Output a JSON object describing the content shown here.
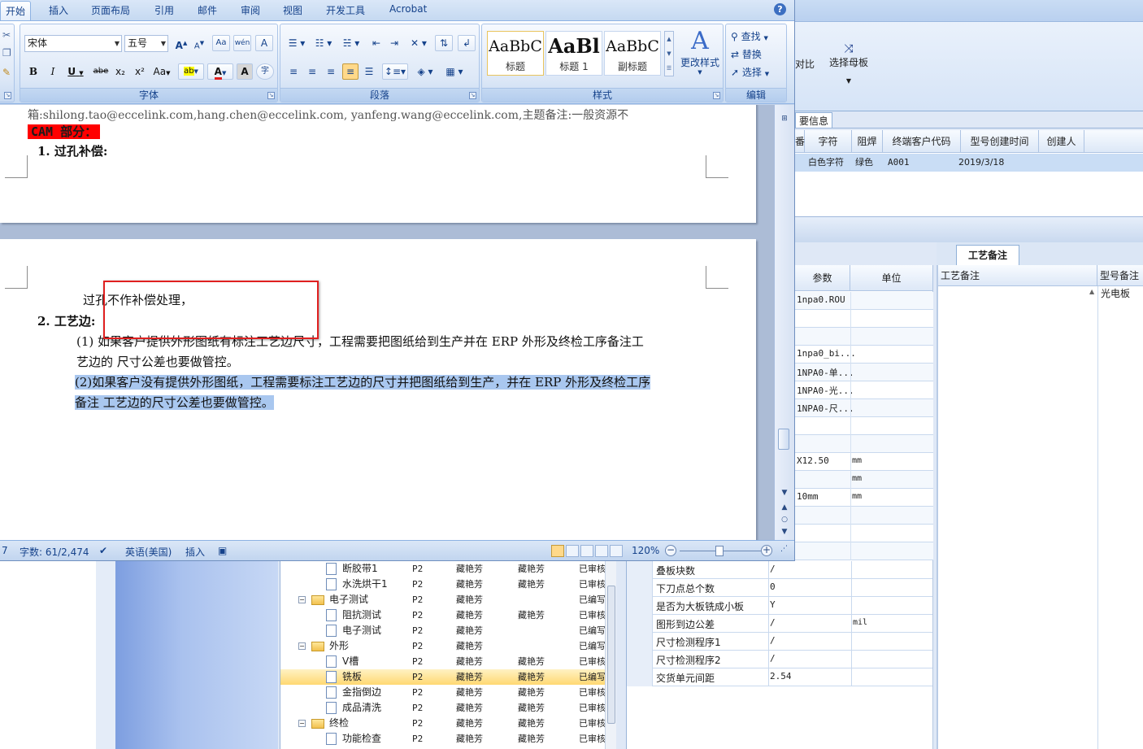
{
  "word": {
    "tabs": [
      "开始",
      "插入",
      "页面布局",
      "引用",
      "邮件",
      "审阅",
      "视图",
      "开发工具",
      "Acrobat"
    ],
    "font": {
      "name": "宋体",
      "size": "五号",
      "group_label": "字体",
      "btn_grow": "A",
      "btn_shrink": "A",
      "btn_clear": "Aa",
      "btn_phonetic": "wén",
      "btn_border_char": "A",
      "btn_bold": "B",
      "btn_italic": "I",
      "btn_underline": "U",
      "btn_strike": "abe",
      "btn_sub": "x₂",
      "btn_sup": "x²",
      "btn_case": "Aa",
      "btn_highlight": "ab",
      "btn_color": "A",
      "btn_shade": "A",
      "btn_enclose": "字"
    },
    "paragraph": {
      "group_label": "段落"
    },
    "styles": {
      "group_label": "样式",
      "items": [
        {
          "sample": "AaBbC",
          "name": "标题"
        },
        {
          "sample": "AaBl",
          "name": "标题 1"
        },
        {
          "sample": "AaBbC",
          "name": "副标题"
        }
      ],
      "change_styles": "更改样式"
    },
    "editing": {
      "group_label": "编辑",
      "find": "查找",
      "replace": "替换",
      "select": "选择"
    },
    "document": {
      "top_line": "箱:shilong.tao@eccelink.com,hang.chen@eccelink.com, yanfeng.wang@eccelink.com,主题备注:一般资源不",
      "cam_heading": "CAM 部分：",
      "item1": "1. 过孔补偿:",
      "p2_line1": "过孔不作补偿处理，",
      "item2": "2. 工艺边:",
      "para1_line1": "(1) 如果客户提供外形图纸有标注工艺边尺寸，工程需要把图纸给到生产并在 ERP 外形及终检工序备注工",
      "para1_line2": "艺边的 尺寸公差也要做管控。",
      "para2_line1": "(2)如果客户没有提供外形图纸，工程需要标注工艺边的尺寸并把图纸给到生产，并在 ERP 外形及终检工序",
      "para2_line2": "备注  工艺边的尺寸公差也要做管控。"
    },
    "status": {
      "page": "7",
      "words": "字数: 61/2,474",
      "language": "英语(美国)",
      "mode": "插入",
      "zoom": "120%"
    }
  },
  "erp": {
    "ribbon": {
      "compare": "对比",
      "select_template": "选择母板"
    },
    "info_tab": "要信息",
    "grid_headers": [
      "番",
      "字符",
      "阻焊",
      "终端客户代码",
      "型号创建时间",
      "创建人"
    ],
    "grid_row": [
      "",
      "白色字符",
      "绿色",
      "A001",
      "2019/3/18",
      ""
    ],
    "param_headers": {
      "param": "参数",
      "unit": "单位"
    },
    "param_rows": [
      {
        "v": "1npa0.ROU",
        "u": ""
      },
      {
        "v": "",
        "u": ""
      },
      {
        "v": "",
        "u": ""
      },
      {
        "v": "1npa0_bi...",
        "u": ""
      },
      {
        "v": "1NPA0-单...",
        "u": ""
      },
      {
        "v": "1NPA0-光...",
        "u": ""
      },
      {
        "v": "1NPA0-尺...",
        "u": ""
      },
      {
        "v": "",
        "u": ""
      },
      {
        "v": "",
        "u": ""
      },
      {
        "v": "X12.50",
        "u": "mm"
      },
      {
        "v": "",
        "u": "mm"
      },
      {
        "v": "10mm",
        "u": "mm"
      },
      {
        "v": "",
        "u": ""
      },
      {
        "v": "",
        "u": ""
      },
      {
        "v": "",
        "u": ""
      }
    ],
    "note_tab": "工艺备注",
    "note_headers": {
      "process_note": "工艺备注",
      "model_note": "型号备注"
    },
    "model_note_value": "光电板",
    "tree": [
      {
        "level": 2,
        "type": "doc",
        "name": "断胶带1",
        "p": "P2",
        "a": "藏艳芳",
        "b": "藏艳芳",
        "s": "已审核"
      },
      {
        "level": 2,
        "type": "doc",
        "name": "水洗烘干1",
        "p": "P2",
        "a": "藏艳芳",
        "b": "藏艳芳",
        "s": "已审核"
      },
      {
        "level": 1,
        "type": "folder",
        "name": "电子测试",
        "p": "P2",
        "a": "藏艳芳",
        "b": "",
        "s": "已编写"
      },
      {
        "level": 2,
        "type": "doc",
        "name": "阻抗测试",
        "p": "P2",
        "a": "藏艳芳",
        "b": "藏艳芳",
        "s": "已审核"
      },
      {
        "level": 2,
        "type": "doc",
        "name": "电子测试",
        "p": "P2",
        "a": "藏艳芳",
        "b": "",
        "s": "已编写"
      },
      {
        "level": 1,
        "type": "folder",
        "name": "外形",
        "p": "P2",
        "a": "藏艳芳",
        "b": "",
        "s": "已编写"
      },
      {
        "level": 2,
        "type": "doc",
        "name": "V槽",
        "p": "P2",
        "a": "藏艳芳",
        "b": "藏艳芳",
        "s": "已审核"
      },
      {
        "level": 2,
        "type": "doc",
        "name": "铣板",
        "p": "P2",
        "a": "藏艳芳",
        "b": "藏艳芳",
        "s": "已编写",
        "selected": true
      },
      {
        "level": 2,
        "type": "doc",
        "name": "金指倒边",
        "p": "P2",
        "a": "藏艳芳",
        "b": "藏艳芳",
        "s": "已审核"
      },
      {
        "level": 2,
        "type": "doc",
        "name": "成品清洗",
        "p": "P2",
        "a": "藏艳芳",
        "b": "藏艳芳",
        "s": "已审核"
      },
      {
        "level": 1,
        "type": "folder",
        "name": "终检",
        "p": "P2",
        "a": "藏艳芳",
        "b": "藏艳芳",
        "s": "已审核"
      },
      {
        "level": 2,
        "type": "doc",
        "name": "功能检查",
        "p": "P2",
        "a": "藏艳芳",
        "b": "藏艳芳",
        "s": "已审核"
      }
    ],
    "props": [
      {
        "k": "叠板块数",
        "v": "/",
        "u": ""
      },
      {
        "k": "下刀点总个数",
        "v": "0",
        "u": ""
      },
      {
        "k": "是否为大板铣成小板",
        "v": "Y",
        "u": ""
      },
      {
        "k": "图形到边公差",
        "v": "/",
        "u": "mil"
      },
      {
        "k": "尺寸检测程序1",
        "v": "/",
        "u": ""
      },
      {
        "k": "尺寸检测程序2",
        "v": "/",
        "u": ""
      },
      {
        "k": "交货单元间距",
        "v": "2.54",
        "u": ""
      }
    ]
  }
}
